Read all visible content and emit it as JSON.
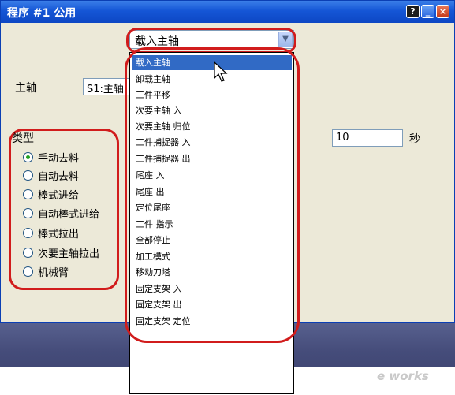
{
  "window": {
    "title": "程序 #1 公用",
    "help_label": "?",
    "min_label": "_",
    "close_label": "×"
  },
  "spindle": {
    "label": "主轴",
    "value": "S1:主轴"
  },
  "type_group": {
    "legend": "类型",
    "options": [
      {
        "label": "手动去料",
        "checked": true
      },
      {
        "label": "自动去料",
        "checked": false
      },
      {
        "label": "棒式进给",
        "checked": false
      },
      {
        "label": "自动棒式进给",
        "checked": false
      },
      {
        "label": "棒式拉出",
        "checked": false
      },
      {
        "label": "次要主轴拉出",
        "checked": false
      },
      {
        "label": "机械臂",
        "checked": false
      }
    ]
  },
  "time": {
    "value": "10",
    "unit": "秒"
  },
  "combo": {
    "value": "载入主轴",
    "items": [
      "载入主轴",
      "卸载主轴",
      "工件平移",
      "次要主轴 入",
      "次要主轴 归位",
      "工件捕捉器 入",
      "工件捕捉器 出",
      "尾座 入",
      "尾座 出",
      "定位尾座",
      "工件 指示",
      "全部停止",
      "加工模式",
      "移动刀塔",
      "固定支架 入",
      "固定支架 出",
      "固定支架 定位"
    ],
    "selected_index": 0
  },
  "watermark": "e works",
  "colors": {
    "highlight": "#316ac5",
    "annotation_ring": "#d11c1c",
    "titlebar": "#1556d6"
  }
}
